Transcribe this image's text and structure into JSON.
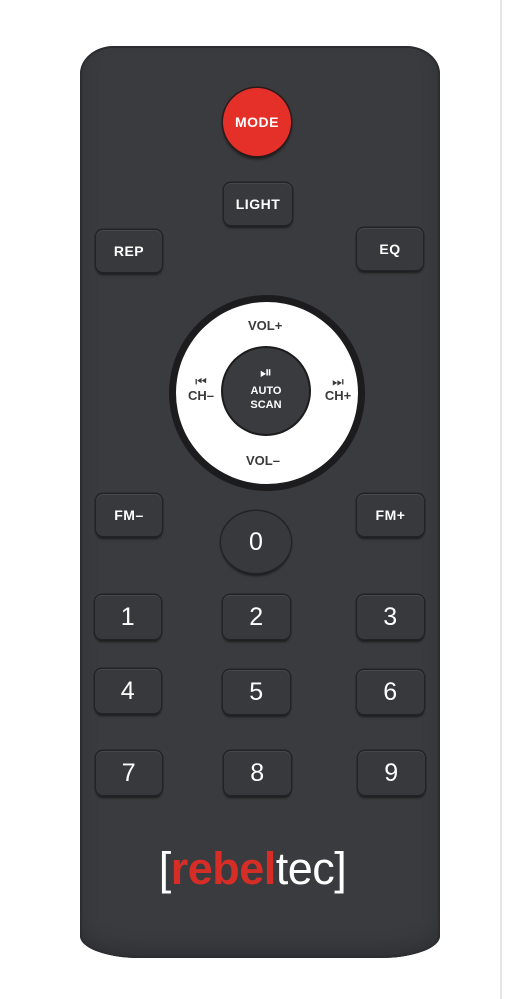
{
  "remote": {
    "mode": "MODE",
    "light": "LIGHT",
    "rep": "REP",
    "eq": "EQ",
    "dpad": {
      "vol_up": "VOL+",
      "vol_down": "VOL–",
      "ch_down": "CH–",
      "ch_up": "CH+",
      "prev_icon": "⏮",
      "next_icon": "⏭",
      "play_icon": "⏯",
      "center_line1": "AUTO",
      "center_line2": "SCAN"
    },
    "fm_minus": "FM–",
    "fm_plus": "FM+",
    "digits": [
      "0",
      "1",
      "2",
      "3",
      "4",
      "5",
      "6",
      "7",
      "8",
      "9"
    ]
  },
  "brand": {
    "bracket_open": "[",
    "red_part": "rebel",
    "white_part": "tec",
    "bracket_close": "]"
  },
  "colors": {
    "body": "#3a3b3e",
    "mode_button": "#e5302a",
    "brand_red": "#d62d27",
    "dpad_ring": "#ffffff"
  }
}
